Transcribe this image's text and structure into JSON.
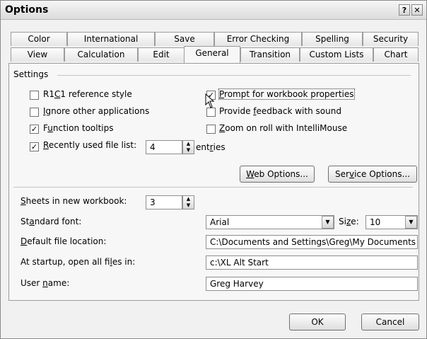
{
  "window": {
    "title": "Options",
    "help_glyph": "?",
    "close_glyph": "✕"
  },
  "tabs": {
    "row1": [
      "Color",
      "International",
      "Save",
      "Error Checking",
      "Spelling",
      "Security"
    ],
    "row2": [
      "View",
      "Calculation",
      "Edit",
      "General",
      "Transition",
      "Custom Lists",
      "Chart"
    ],
    "active": "General"
  },
  "settings": {
    "group_label": "Settings",
    "r1c1": {
      "a": "R1",
      "k": "C",
      "b": "1 reference style",
      "checked": false
    },
    "ignore_apps": {
      "a": "",
      "k": "I",
      "b": "gnore other applications",
      "checked": false
    },
    "function_tooltips": {
      "a": "F",
      "k": "u",
      "b": "nction tooltips",
      "checked": true
    },
    "recent_files": {
      "a": "",
      "k": "R",
      "b": "ecently used file list:",
      "checked": true,
      "value": "4",
      "suffix_a": "ent",
      "suffix_k": "r",
      "suffix_b": "ies"
    },
    "prompt_props": {
      "a": "",
      "k": "P",
      "b": "rompt for workbook properties",
      "checked": true
    },
    "feedback_sound": {
      "a": "Provide ",
      "k": "f",
      "b": "eedback with sound",
      "checked": false
    },
    "zoom_intellimouse": {
      "a": "",
      "k": "Z",
      "b": "oom on roll with IntelliMouse",
      "checked": false
    },
    "web_options": {
      "a": "",
      "k": "W",
      "b": "eb Options..."
    },
    "service_options": {
      "a": "Ser",
      "k": "v",
      "b": "ice Options..."
    }
  },
  "workbook": {
    "sheets": {
      "a": "",
      "k": "S",
      "b": "heets in new workbook:",
      "value": "3"
    },
    "std_font": {
      "a": "St",
      "k": "a",
      "b": "ndard font:",
      "value": "Arial"
    },
    "size": {
      "a": "Si",
      "k": "z",
      "b": "e:",
      "value": "10"
    },
    "default_loc": {
      "a": "",
      "k": "D",
      "b": "efault file location:",
      "value": "C:\\Documents and Settings\\Greg\\My Documents"
    },
    "startup": {
      "a": "At startup, open all fi",
      "k": "l",
      "b": "es in:",
      "value": "c:\\XL Alt Start"
    },
    "user_name": {
      "a": "User ",
      "k": "n",
      "b": "ame:",
      "value": "Greg Harvey"
    }
  },
  "buttons": {
    "ok": "OK",
    "cancel": "Cancel"
  },
  "glyphs": {
    "check": "✓",
    "up": "▲",
    "down": "▼"
  }
}
